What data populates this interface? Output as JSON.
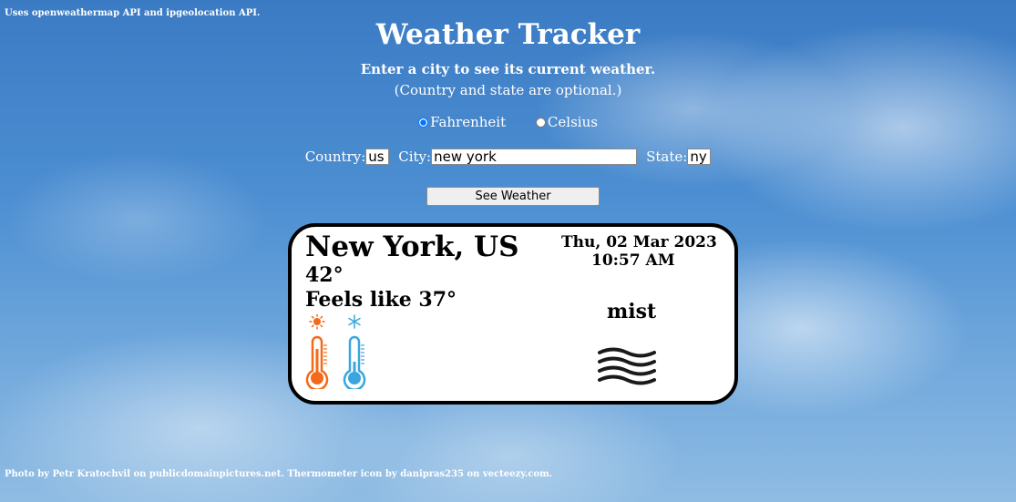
{
  "credits": {
    "top": "Uses openweathermap API and ipgeolocation API.",
    "bottom": "Photo by Petr Kratochvil on publicdomainpictures.net. Thermometer icon by danipras235 on vecteezy.com."
  },
  "header": {
    "title": "Weather Tracker",
    "subtitle": "Enter a city to see its current weather.",
    "note": "(Country and state are optional.)"
  },
  "units": {
    "fahrenheit_label": "Fahrenheit",
    "celsius_label": "Celsius",
    "selected": "Fahrenheit"
  },
  "form": {
    "country_label": "Country:",
    "country_value": "us",
    "city_label": "City:",
    "city_value": "new york",
    "state_label": "State:",
    "state_value": "ny",
    "button_label": "See Weather"
  },
  "weather": {
    "location": "New York, US",
    "temperature": "42°",
    "feels_like": "Feels like 37°",
    "date": "Thu, 02 Mar 2023",
    "time": "10:57 AM",
    "description": "mist",
    "icons": [
      "hot-thermometer-icon",
      "cold-thermometer-icon",
      "mist-icon"
    ]
  },
  "colors": {
    "hot": "#f26a1b",
    "cold": "#3aa6dd"
  }
}
